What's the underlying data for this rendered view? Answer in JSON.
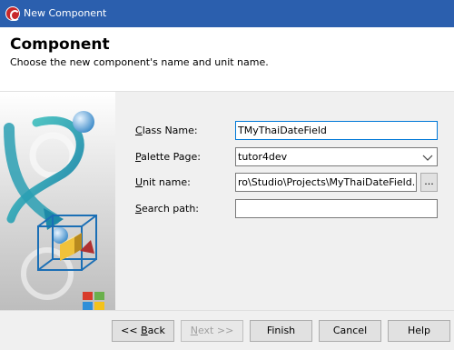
{
  "window": {
    "title": "New Component"
  },
  "header": {
    "title": "Component",
    "subtitle": "Choose the new component's name and unit name."
  },
  "form": {
    "class_name": {
      "label_accel": "C",
      "label_rest": "lass Name:",
      "value": "TMyThaiDateField"
    },
    "palette_page": {
      "label_accel": "P",
      "label_rest": "alette Page:",
      "value": "tutor4dev"
    },
    "unit_name": {
      "label_accel": "U",
      "label_rest": "nit name:",
      "value": "ro\\Studio\\Projects\\MyThaiDateField.pas",
      "browse_label": "..."
    },
    "search_path": {
      "label_accel": "S",
      "label_rest": "earch path:",
      "value": ""
    }
  },
  "buttons": {
    "back_prefix": "<< ",
    "back_accel": "B",
    "back_rest": "ack",
    "next_accel": "N",
    "next_rest": "ext >>",
    "finish": "Finish",
    "cancel": "Cancel",
    "help": "Help"
  },
  "colors": {
    "titlebar": "#2b5fae",
    "focus": "#0078d7",
    "panel": "#f0f0f0"
  }
}
